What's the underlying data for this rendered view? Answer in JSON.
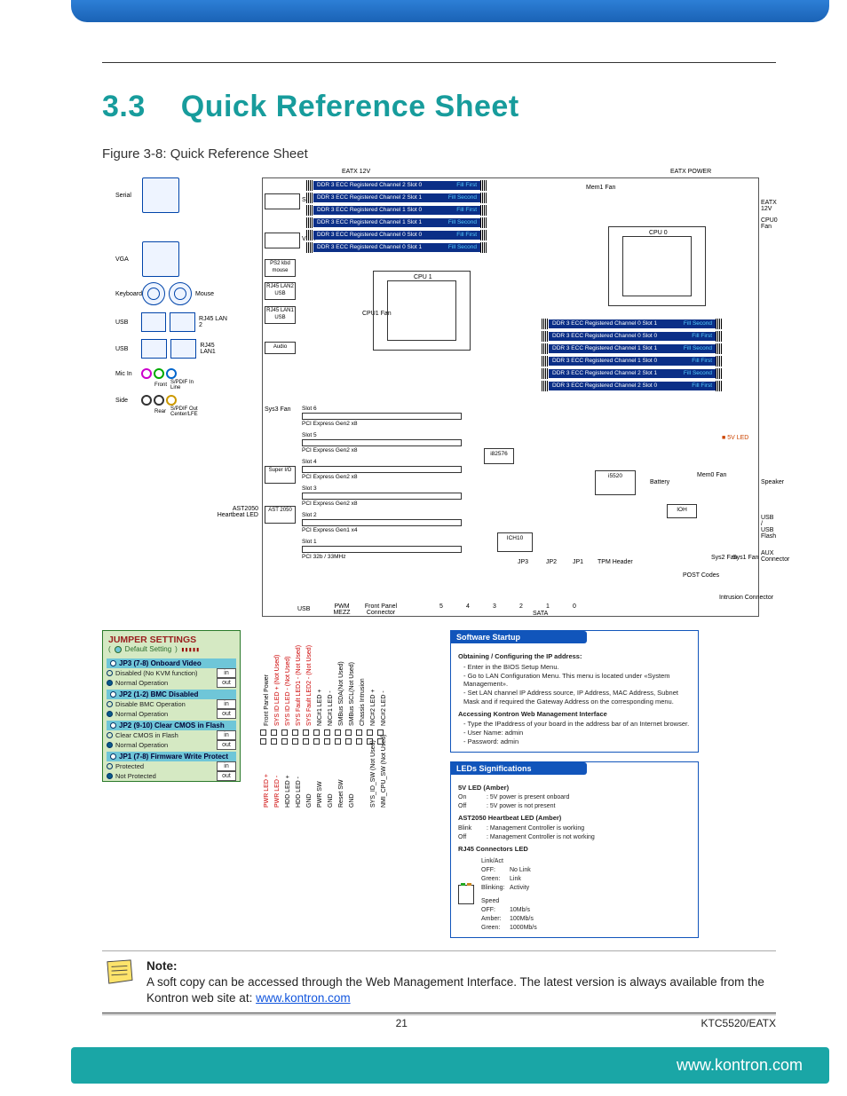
{
  "chapter_number": "3.3",
  "chapter_title": "Quick Reference Sheet",
  "figure_caption": "Figure 3-8: Quick Reference Sheet",
  "diagram": {
    "top_labels": {
      "eatx12v_left": "EATX 12V",
      "eatx_power": "EATX POWER",
      "eatx12v_right": "EATX 12V",
      "cpu0_fan": "CPU0 Fan",
      "mem1_fan": "Mem1 Fan"
    },
    "io": {
      "serial": "Serial",
      "vga": "VGA",
      "keyboard": "Keyboard",
      "mouse": "Mouse",
      "usb": "USB",
      "rj45_lan2": "RJ45  LAN 2",
      "rj45_lan1": "RJ45  LAN1",
      "mic_in": "Mic In",
      "side": "Side",
      "front": "Front",
      "rear": "Rear",
      "spdif_in": "S/PDIF In",
      "line": "Line",
      "spdif_out": "S/PDIF Out",
      "center_lfe": "Center/LFE"
    },
    "mb_ports": {
      "serial_h": "Serial",
      "vga_h": "VGA",
      "ps2": "PS2 kbd mouse",
      "rj45_lan2_usb": "RJ45 LAN2 USB",
      "rj45_lan1_usb": "RJ45 LAN1 USB",
      "audio": "Audio",
      "super_io": "Super I/O",
      "ast2050": "AST 2050",
      "ast_led": "AST2050 Heartbeat LED",
      "sys3_fan": "Sys3 Fan",
      "cpu1_fan": "CPU1 Fan",
      "usb_foot": "USB",
      "pwm_mezz": "PWM MEZZ",
      "front_panel": "Front Panel Connector",
      "sata": "SATA",
      "sata_ports": [
        "5",
        "4",
        "3",
        "2",
        "1",
        "0"
      ]
    },
    "dimms_left": [
      {
        "t": "DDR 3 ECC Registered Channel 2 Slot 0",
        "f": "Fill First"
      },
      {
        "t": "DDR 3 ECC Registered Channel 2 Slot 1",
        "f": "Fill Second"
      },
      {
        "t": "DDR 3 ECC Registered Channel 1 Slot 0",
        "f": "Fill First"
      },
      {
        "t": "DDR 3 ECC Registered Channel 1 Slot 1",
        "f": "Fill Second"
      },
      {
        "t": "DDR 3 ECC Registered Channel 0 Slot 0",
        "f": "Fill First"
      },
      {
        "t": "DDR 3 ECC Registered Channel 0 Slot 1",
        "f": "Fill Second"
      }
    ],
    "dimms_right": [
      {
        "t": "DDR 3 ECC Registered Channel 0 Slot 1",
        "f": "Fill Second"
      },
      {
        "t": "DDR 3 ECC Registered Channel 0 Slot 0",
        "f": "Fill First"
      },
      {
        "t": "DDR 3 ECC Registered Channel 1 Slot 1",
        "f": "Fill Second"
      },
      {
        "t": "DDR 3 ECC Registered Channel 1 Slot 0",
        "f": "Fill First"
      },
      {
        "t": "DDR 3 ECC Registered Channel 2 Slot 1",
        "f": "Fill Second"
      },
      {
        "t": "DDR 3 ECC Registered Channel 2 Slot 0",
        "f": "Fill First"
      }
    ],
    "cpu0": "CPU 0",
    "cpu1": "CPU 1",
    "slots": [
      {
        "n": "Slot 6",
        "d": "PCI Express Gen2 x8"
      },
      {
        "n": "Slot 5",
        "d": "PCI Express Gen2 x8"
      },
      {
        "n": "Slot 4",
        "d": "PCI Express Gen2 x8"
      },
      {
        "n": "Slot 3",
        "d": "PCI Express Gen2 x8"
      },
      {
        "n": "Slot 2",
        "d": "PCI Express Gen1 x4"
      },
      {
        "n": "Slot 1",
        "d": "PCI 32b / 33MHz"
      }
    ],
    "chips": {
      "i82576": "i82576",
      "i5520": "i5520",
      "ich10": "ICH10",
      "ioh": "IOH"
    },
    "right_side": {
      "five_v_led": "5V LED",
      "battery": "Battery",
      "mem0_fan": "Mem0 Fan",
      "speaker": "Speaker",
      "usb_flash": "USB / USB Flash",
      "sys2_fan": "Sys2 Fan",
      "sys1_fan": "Sys1 Fan",
      "aux": "AUX Connector",
      "post": "POST Codes",
      "intrusion": "Intrusion Connector",
      "tpm": "TPM Header",
      "jp": [
        "JP3",
        "JP2",
        "JP1"
      ]
    }
  },
  "jumper": {
    "title": "JUMPER SETTINGS",
    "subtitle": "Default Setting",
    "groups": [
      {
        "header": "JP3 (7-8) Onboard Video",
        "rows": [
          {
            "txt": "Disabled (No KVM function)",
            "state": "in",
            "default": false
          },
          {
            "txt": "Normal Operation",
            "state": "out",
            "default": true
          }
        ]
      },
      {
        "header": "JP2 (1-2) BMC Disabled",
        "rows": [
          {
            "txt": "Disable BMC Operation",
            "state": "in",
            "default": false
          },
          {
            "txt": "Normal Operation",
            "state": "out",
            "default": true
          }
        ]
      },
      {
        "header": "JP2 (9-10) Clear CMOS in Flash",
        "rows": [
          {
            "txt": "Clear CMOS in Flash",
            "state": "in",
            "default": false
          },
          {
            "txt": "Normal Operation",
            "state": "out",
            "default": true
          }
        ]
      },
      {
        "header": "JP1 (7-8) Firmware Write Protect",
        "rows": [
          {
            "txt": "Protected",
            "state": "in",
            "default": false
          },
          {
            "txt": "Not Protected",
            "state": "out",
            "default": true
          }
        ]
      }
    ]
  },
  "front_panel_pins": {
    "top": [
      "Front Panel Power",
      "SYS ID LED + (Not Used)",
      "SYS ID LED - (Not Used)",
      "SYS Fault LED1 - (Not Used)",
      "SYS Fault LED2 - (Not Used)",
      "NIC#1 LED +",
      "NIC#1 LED -",
      "SMBus SDA(Not Used)",
      "SMBus SCL(Not Used)",
      "Chassis Intrusion",
      "NIC#2 LED +",
      "NIC#2 LED -"
    ],
    "bottom": [
      "PWR LED +",
      "PWR LED -",
      "HDD LED +",
      "HDD LED -",
      "GND",
      "PWR SW",
      "GND",
      "Reset SW",
      "GND",
      "",
      "SYS_ID_SW (Not Used)",
      "NMI_CPU_SW (Not Used)"
    ]
  },
  "software_startup": {
    "title": "Software Startup",
    "h1": "Obtaining / Configuring the IP address:",
    "l1": [
      "Enter in the BIOS Setup Menu.",
      "Go to LAN Configuration Menu. This menu is located under «System Management».",
      "Set LAN channel IP Address source, IP Address, MAC Address, Subnet Mask and if required the Gateway Address on the corresponding menu."
    ],
    "h2": "Accessing Kontron Web Management Interface",
    "l2": [
      "Type the IPaddress of your board in the address bar of an Internet browser.",
      "User Name: admin",
      "Password: admin"
    ]
  },
  "leds": {
    "title": "LEDs Significations",
    "h1": "5V LED (Amber)",
    "r1": [
      {
        "k": "On",
        "v": ": 5V power is present onboard"
      },
      {
        "k": "Off",
        "v": ": 5V power is not present"
      }
    ],
    "h2": "AST2050 Heartbeat LED (Amber)",
    "r2": [
      {
        "k": "Blink",
        "v": ": Management Controller is working"
      },
      {
        "k": "Off",
        "v": ": Management Controller is not working"
      }
    ],
    "h3": "RJ45 Connectors LED",
    "linkact": {
      "title": "Link/Act",
      "rows": [
        {
          "k": "OFF:",
          "v": "No Link"
        },
        {
          "k": "Green:",
          "v": "Link"
        },
        {
          "k": "Blinking:",
          "v": "Activity"
        }
      ]
    },
    "speed": {
      "title": "Speed",
      "rows": [
        {
          "k": "OFF:",
          "v": "10Mb/s"
        },
        {
          "k": "Amber:",
          "v": "100Mb/s"
        },
        {
          "k": "Green:",
          "v": "1000Mb/s"
        }
      ]
    }
  },
  "note": {
    "title": "Note:",
    "body_pre": "A soft copy can be accessed through the Web Management Interface. The latest version is always available from the Kontron web site at: ",
    "link": "www.kontron.com"
  },
  "footer": {
    "page": "21",
    "doc": "KTC5520/EATX",
    "url": "www.kontron.com"
  }
}
